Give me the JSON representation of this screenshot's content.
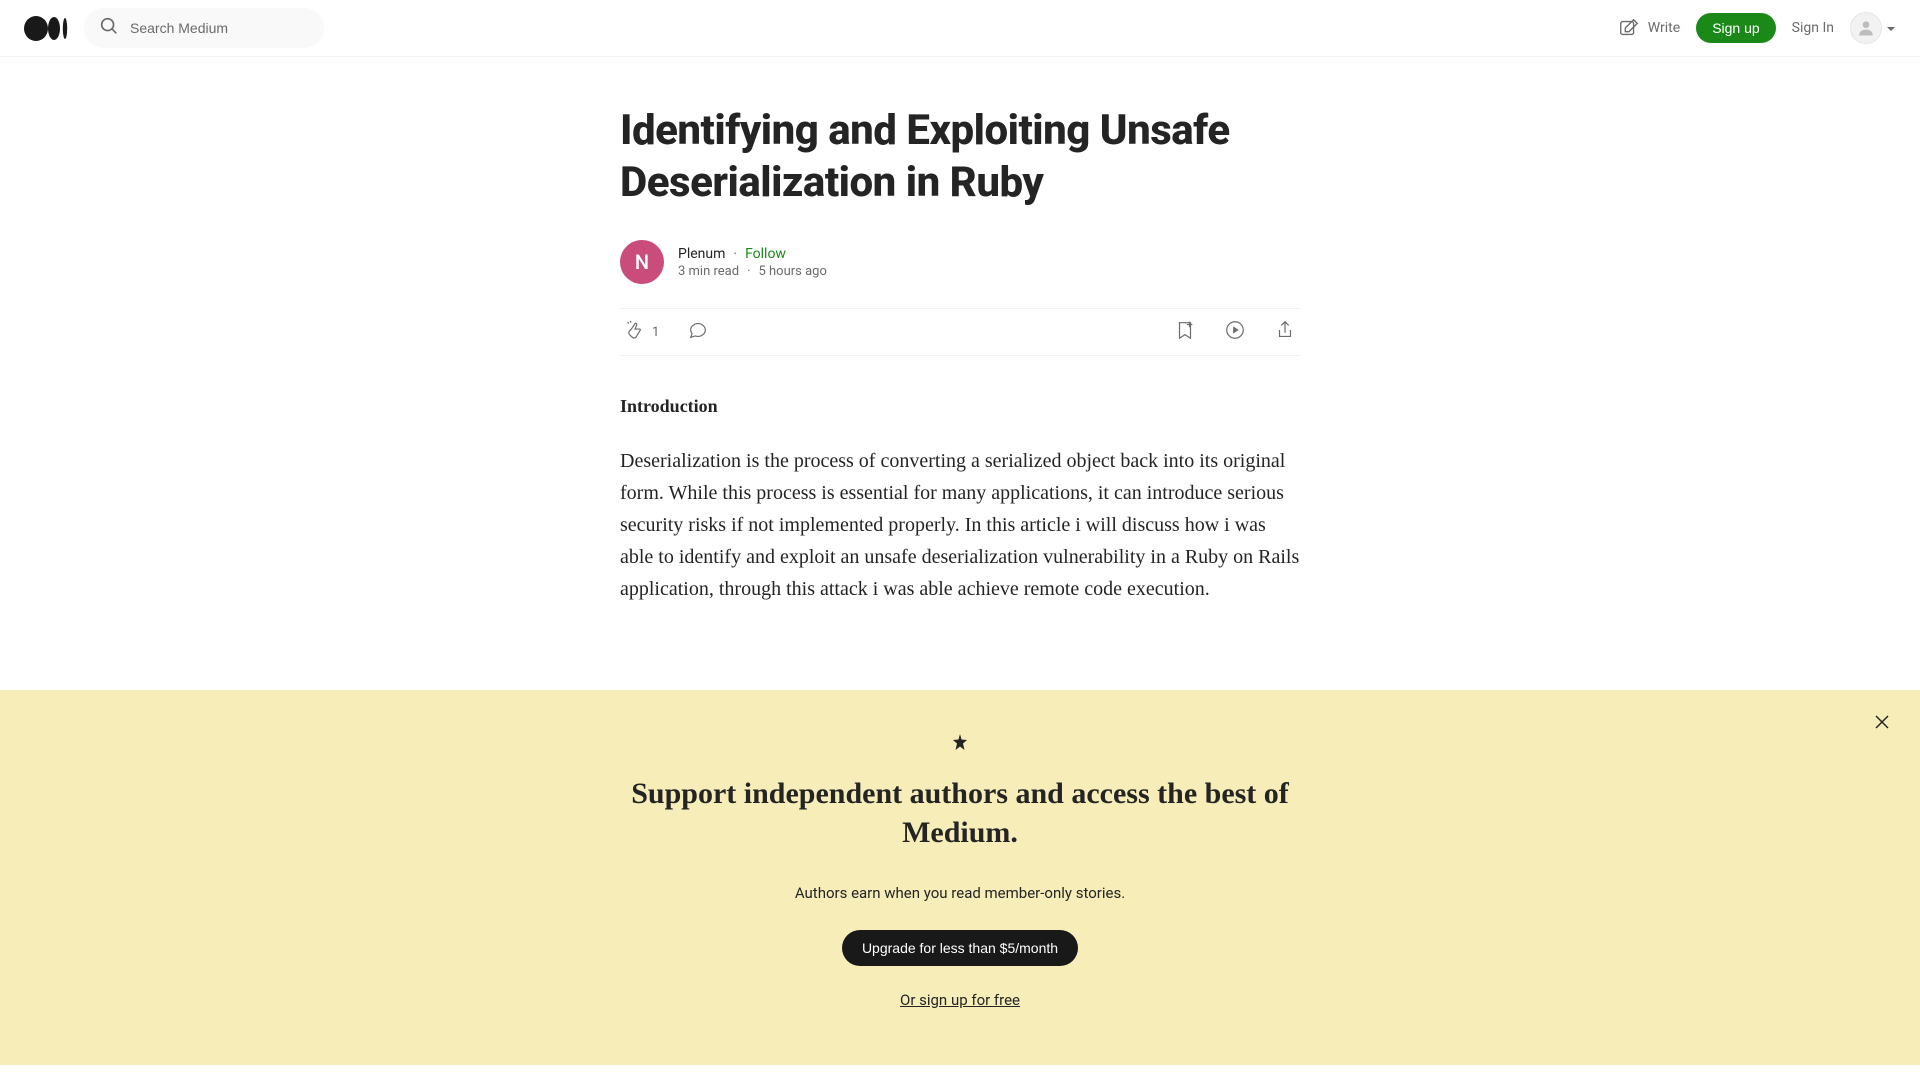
{
  "header": {
    "search_placeholder": "Search Medium",
    "write_label": "Write",
    "signup_label": "Sign up",
    "signin_label": "Sign In"
  },
  "article": {
    "title": "Identifying and Exploiting Unsafe Deserialization in Ruby",
    "author_name": "Plenum",
    "author_initial": "N",
    "follow_label": "Follow",
    "read_time": "3 min read",
    "published": "5 hours ago",
    "clap_count": "1",
    "section_heading": "Introduction",
    "body": "Deserialization is the process of converting a serialized object back into its original form. While this process is essential for many applications, it can introduce serious security risks if not implemented properly. In this article i will discuss how i was able to identify and exploit an unsafe deserialization vulnerability in a Ruby on Rails application, through this attack i was able achieve remote code execution."
  },
  "banner": {
    "headline": "Support independent authors and access the best of Medium.",
    "subtext": "Authors earn when you read member-only stories.",
    "upgrade_label": "Upgrade for less than $5/month",
    "free_label": "Or sign up for free"
  },
  "colors": {
    "accent_green": "#1a8917",
    "banner_bg": "#f7edb8",
    "author_avatar_bg": "#c94c7b"
  }
}
